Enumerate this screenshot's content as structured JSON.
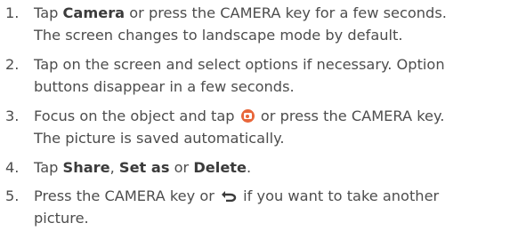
{
  "steps": [
    {
      "num": "1.",
      "line1": {
        "pre": "Tap ",
        "bold": "Camera",
        "post": " or press the CAMERA key for a few seconds."
      },
      "line2": "The screen changes to landscape mode by default."
    },
    {
      "num": "2.",
      "line1": "Tap on the screen and select options if necessary. Option",
      "line2": "buttons disappear in a few seconds."
    },
    {
      "num": "3.",
      "line1": {
        "pre": "Focus on the object and tap ",
        "icon": "camera-shutter-icon",
        "post": " or press the CAMERA key."
      },
      "line2": "The picture is saved automatically."
    },
    {
      "num": "4.",
      "pre": "Tap ",
      "bold1": "Share",
      "sep": ", ",
      "bold2": "Set as",
      "or": " or ",
      "bold3": "Delete",
      "end": "."
    },
    {
      "num": "5.",
      "line1": {
        "pre": "Press the CAMERA key or ",
        "icon": "back-arrow-icon",
        "post": " if you want to take another"
      },
      "line2": "picture."
    }
  ],
  "colors": {
    "text": "#4d4d4d",
    "camera_icon": "#e8663a"
  }
}
